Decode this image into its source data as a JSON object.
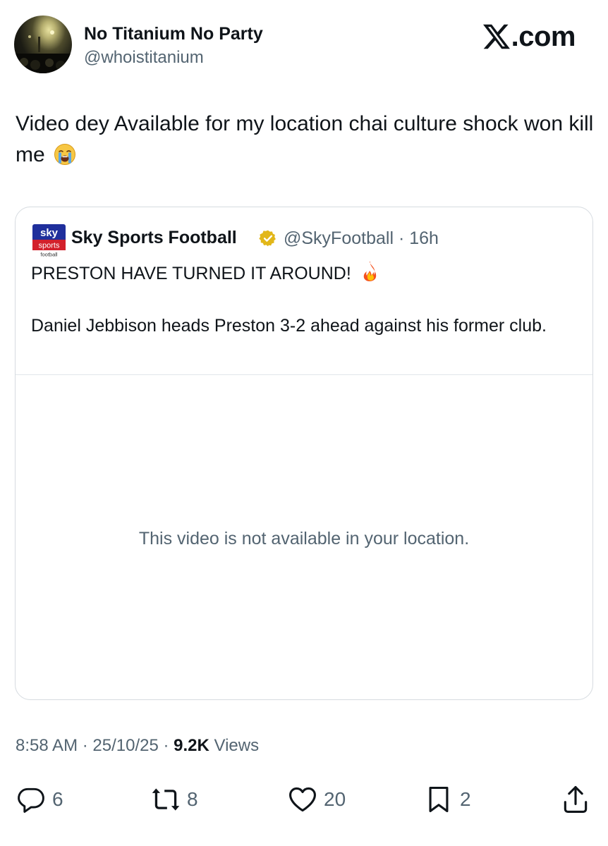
{
  "author": {
    "name": "No Titanium No Party",
    "handle": "@whoistitanium"
  },
  "brand": {
    "text": ".com"
  },
  "tweet": {
    "text": "Video dey Available for my location chai culture shock won kill me",
    "emoji": "loudly-crying-face-icon"
  },
  "quoted": {
    "logo_lines": [
      "sky",
      "sports",
      "football"
    ],
    "name": "Sky Sports Football",
    "handle_time": "@SkyFootball · 16h",
    "line1": "PRESTON HAVE TURNED IT AROUND!",
    "line1_emoji": "fire-icon",
    "line2": "Daniel Jebbison heads Preston 3-2 ahead against his former club.",
    "media_notice": "This video is not available in your location."
  },
  "meta": {
    "time_date": "8:58 AM · 25/10/25 · ",
    "views_count": "9.2K",
    "views_label": " Views"
  },
  "actions": {
    "replies": "6",
    "reposts": "8",
    "likes": "20",
    "bookmarks": "2"
  },
  "colors": {
    "text": "#0f1419",
    "secondary": "#536471",
    "border": "#d6dbe0",
    "badge_gold": "#e2b719",
    "sky_blue": "#1f2f9c",
    "sky_red": "#d3202b"
  }
}
